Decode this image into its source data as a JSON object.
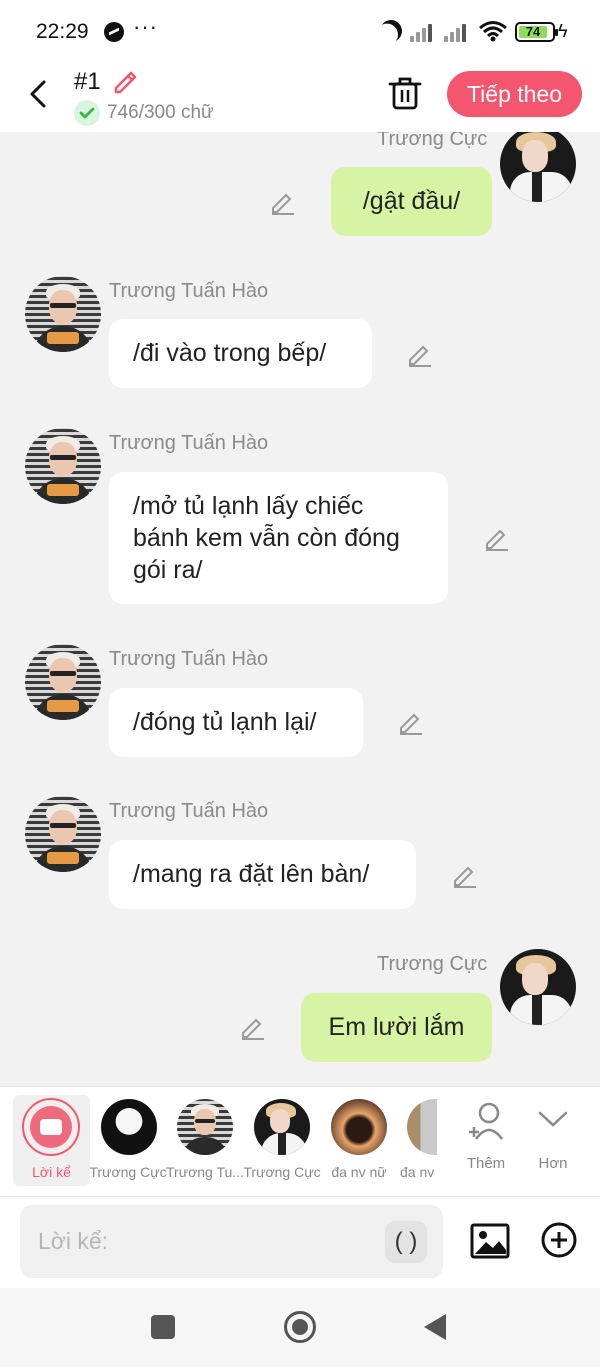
{
  "status_bar": {
    "time": "22:29",
    "dots": "···",
    "battery": "74",
    "icons": [
      "messenger-icon",
      "moon-icon",
      "signal-icon",
      "wifi-icon",
      "battery-icon",
      "charging-icon"
    ]
  },
  "header": {
    "title": "#1",
    "word_count": "746/300 chữ",
    "next_label": "Tiếp theo",
    "accent": "#f4566f"
  },
  "messages": [
    {
      "side": "right",
      "sender": "Trương Cực",
      "text": "/gật đầu/"
    },
    {
      "side": "left",
      "sender": "Trương Tuấn Hào",
      "text": "/đi vào trong bếp/"
    },
    {
      "side": "left",
      "sender": "Trương Tuấn Hào",
      "text": "/mở tủ lạnh lấy chiếc bánh kem vẫn còn đóng gói ra/"
    },
    {
      "side": "left",
      "sender": "Trương Tuấn Hào",
      "text": "/đóng tủ lạnh lại/"
    },
    {
      "side": "left",
      "sender": "Trương Tuấn Hào",
      "text": "/mang ra đặt lên bàn/"
    },
    {
      "side": "right",
      "sender": "Trương Cực",
      "text": "Em lười lắm"
    }
  ],
  "characters": {
    "narrator_label": "Lời kể",
    "items": [
      {
        "label": "Trương Cực"
      },
      {
        "label": "Trương Tu..."
      },
      {
        "label": "Trương Cực"
      },
      {
        "label": "đa nv nữ"
      },
      {
        "label": "đa nv"
      }
    ],
    "add_label": "Thêm",
    "more_label": "Hơn"
  },
  "input": {
    "placeholder": "Lời kể:",
    "paren_label": "( )"
  },
  "colors": {
    "bubble_right": "#d7f4a4",
    "bubble_left": "#ffffff",
    "background": "#f2f2f2"
  }
}
